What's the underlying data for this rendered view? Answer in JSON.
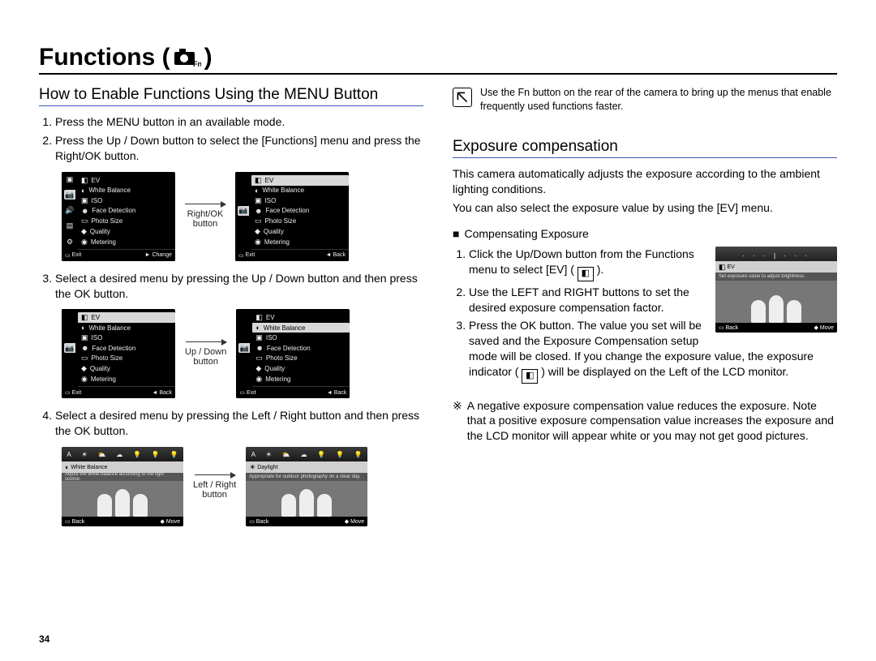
{
  "title": {
    "prefix": "Functions (",
    "suffix": " )"
  },
  "page_number": "34",
  "left": {
    "heading": "How to Enable Functions Using the MENU Button",
    "steps": [
      "Press the MENU button in an available mode.",
      "Press the Up / Down button to select the [Functions] menu and press the Right/OK button.",
      "Select a desired menu by pressing the Up / Down button and then press the OK button.",
      "Select a desired menu by pressing the Left / Right button and then press the OK button."
    ],
    "arrow_labels": {
      "a1": "Right/OK",
      "a1b": "button",
      "a2": "Up / Down",
      "a2b": "button",
      "a3": "Left / Right",
      "a3b": "button"
    },
    "screen_a": {
      "tabs": [
        "Mode",
        "Functions",
        "Sound",
        "Display",
        "Settings"
      ],
      "items": [
        "EV",
        "White Balance",
        "ISO",
        "Face Detection",
        "Photo Size",
        "Quality",
        "Metering"
      ],
      "foot_left": "Exit",
      "foot_right": "Change"
    },
    "screen_b": {
      "items": [
        "EV",
        "White Balance",
        "ISO",
        "Face Detection",
        "Photo Size",
        "Quality",
        "Metering"
      ],
      "foot_left": "Exit",
      "foot_right": "Back"
    },
    "screen_c": {
      "items": [
        "EV",
        "White Balance",
        "ISO",
        "Face Detection",
        "Photo Size",
        "Quality",
        "Metering"
      ],
      "sel_index": 0,
      "foot_left": "Exit",
      "foot_right": "Back"
    },
    "screen_d": {
      "items": [
        "EV",
        "White Balance",
        "ISO",
        "Face Detection",
        "Photo Size",
        "Quality",
        "Metering"
      ],
      "sel_index": 1,
      "foot_left": "Exit",
      "foot_right": "Back"
    },
    "screen_e": {
      "hdr_icons": [
        "A",
        "☀",
        "⛅",
        "☁",
        "💡",
        "💡",
        "💡"
      ],
      "label": "White Balance",
      "caption": "Adjust the white balance according to the light source.",
      "foot_left": "Back",
      "foot_right": "Move"
    },
    "screen_f": {
      "hdr_icons": [
        "A",
        "☀",
        "⛅",
        "☁",
        "💡",
        "💡",
        "💡"
      ],
      "label": "Daylight",
      "caption": "Appropriate for outdoor photography on a clear day.",
      "foot_left": "Back",
      "foot_right": "Move"
    }
  },
  "right": {
    "note": "Use the Fn button on the rear of the camera to bring up the menus that enable frequently used functions faster.",
    "heading": "Exposure compensation",
    "intro1": "This camera automatically adjusts the exposure according to the ambient lighting conditions.",
    "intro2": "You can also select the exposure value by using the [EV] menu.",
    "sub_bullet": "Compensating Exposure",
    "steps": {
      "s1a": "Click the Up/Down button from the Functions menu to select [EV] (",
      "s1b": " ).",
      "s2": "Use the LEFT and RIGHT buttons to set the desired exposure compensation factor.",
      "s3a": "Press the OK button. The value you set will be saved and the Exposure Compensation setup mode will be closed. If you change the exposure value, the exposure indicator (",
      "s3b": " ) will be displayed on the Left of the LCD monitor."
    },
    "ev_screen": {
      "ruler": "· · · | · · ·",
      "label": "EV",
      "caption": "Set exposure value to adjust brightness.",
      "foot_left": "Back",
      "foot_right": "Move"
    },
    "ps_prefix": "※",
    "ps": "A negative exposure compensation value reduces the exposure. Note that a positive exposure compensation value increases the exposure and the LCD monitor will appear white or you may not get good pictures."
  }
}
